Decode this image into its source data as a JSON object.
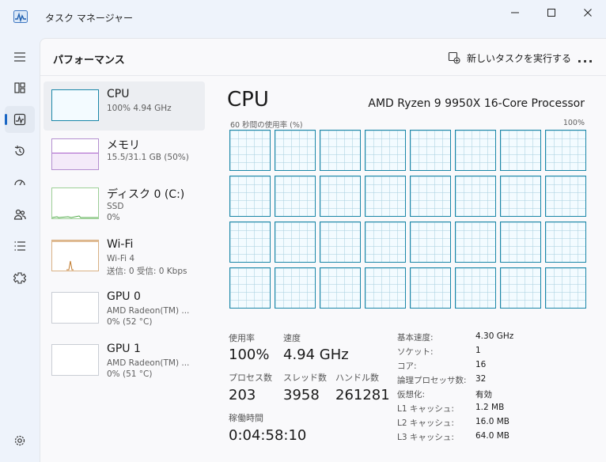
{
  "window": {
    "title": "タスク マネージャー"
  },
  "header": {
    "title": "パフォーマンス",
    "run_new_task": "新しいタスクを実行する",
    "more": "..."
  },
  "nav": [
    {
      "name": "hamburger-icon"
    },
    {
      "name": "processes-icon"
    },
    {
      "name": "performance-icon",
      "active": true
    },
    {
      "name": "history-icon"
    },
    {
      "name": "startup-icon"
    },
    {
      "name": "users-icon"
    },
    {
      "name": "details-icon"
    },
    {
      "name": "services-icon"
    },
    {
      "name": "settings-icon"
    }
  ],
  "resources": [
    {
      "name": "CPU",
      "line1": "100%  4.94 GHz",
      "color": "#1a87a8"
    },
    {
      "name": "メモリ",
      "line1": "15.5/31.1 GB (50%)",
      "color": "#8b2bb8"
    },
    {
      "name": "ディスク 0 (C:)",
      "line1": "SSD",
      "line2": "0%",
      "color": "#4daa45"
    },
    {
      "name": "Wi-Fi",
      "line1": "Wi-Fi 4",
      "line2": "送信: 0 受信: 0 Kbps",
      "color": "#c17a2c"
    },
    {
      "name": "GPU 0",
      "line1": "AMD Radeon(TM) ...",
      "line2": "0%  (52 °C)",
      "color": "#1a87a8"
    },
    {
      "name": "GPU 1",
      "line1": "AMD Radeon(TM) ...",
      "line2": "0%  (51 °C)",
      "color": "#1a87a8"
    }
  ],
  "cpu": {
    "title": "CPU",
    "model": "AMD Ryzen 9 9950X 16-Core Processor",
    "graph_label": "60 秒間の使用率 (%)",
    "graph_max": "100%",
    "core_count": 32,
    "stats": {
      "usage_label": "使用率",
      "usage": "100%",
      "speed_label": "速度",
      "speed": "4.94 GHz",
      "processes_label": "プロセス数",
      "processes": "203",
      "threads_label": "スレッド数",
      "threads": "3958",
      "handles_label": "ハンドル数",
      "handles": "261281",
      "uptime_label": "稼働時間",
      "uptime": "0:04:58:10"
    },
    "info": [
      {
        "k": "基本速度:",
        "v": "4.30 GHz"
      },
      {
        "k": "ソケット:",
        "v": "1"
      },
      {
        "k": "コア:",
        "v": "16"
      },
      {
        "k": "論理プロセッサ数:",
        "v": "32"
      },
      {
        "k": "仮想化:",
        "v": "有効"
      },
      {
        "k": "L1 キャッシュ:",
        "v": "1.2 MB"
      },
      {
        "k": "L2 キャッシュ:",
        "v": "16.0 MB"
      },
      {
        "k": "L3 キャッシュ:",
        "v": "64.0 MB"
      }
    ]
  }
}
